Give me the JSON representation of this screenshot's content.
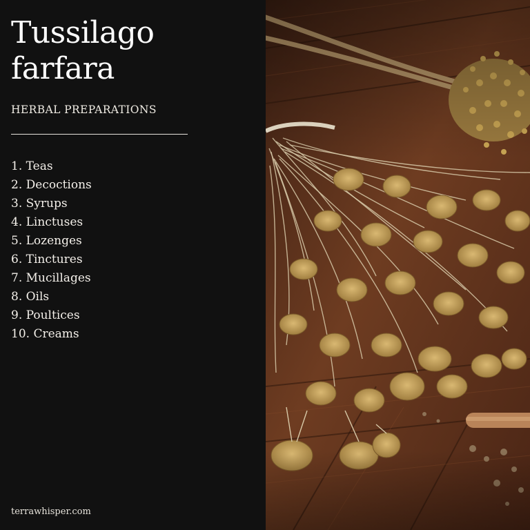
{
  "title_line1": "Tussilago",
  "title_line2": "farfara",
  "subtitle": "HERBAL PREPARATIONS",
  "preparations": [
    "1. Teas",
    "2. Decoctions",
    "3. Syrups",
    "4. Linctuses",
    "5. Lozenges",
    "6. Tinctures",
    "7. Mucillages",
    "8. Oils",
    "9. Poultices",
    "10. Creams"
  ],
  "footer": "terrawhisper.com",
  "colors": {
    "panel_background": "#111111",
    "text": "#ffffff",
    "wood": "#6b3a1f",
    "dried_flower": "#c9a660"
  }
}
